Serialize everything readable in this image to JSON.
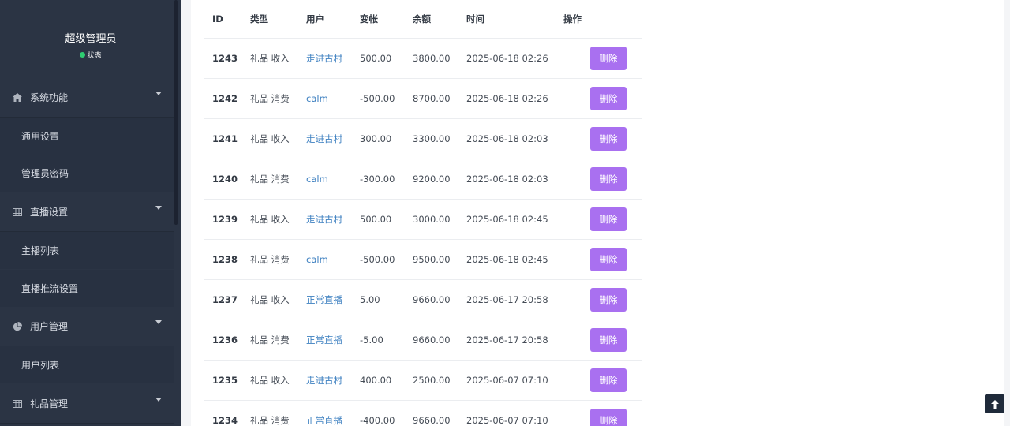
{
  "sidebar": {
    "profile_name": "超级管理员",
    "profile_status": "状态",
    "groups": [
      {
        "label": "系统功能",
        "icon": "home-icon"
      },
      {
        "label": "直播设置",
        "icon": "table-icon"
      },
      {
        "label": "用户管理",
        "icon": "pie-chart-icon"
      },
      {
        "label": "礼品管理",
        "icon": "table-icon"
      }
    ],
    "subitems": [
      "通用设置",
      "管理员密码",
      "主播列表",
      "直播推流设置",
      "用户列表"
    ]
  },
  "table": {
    "headers": [
      "ID",
      "类型",
      "用户",
      "变帐",
      "余额",
      "时间",
      "操作"
    ],
    "delete_label": "删除",
    "rows": [
      {
        "id": "1243",
        "type": "礼品 收入",
        "user": "走进古村",
        "change": "500.00",
        "balance": "3800.00",
        "time": "2025-06-18 02:26"
      },
      {
        "id": "1242",
        "type": "礼品 消费",
        "user": "calm",
        "change": "-500.00",
        "balance": "8700.00",
        "time": "2025-06-18 02:26"
      },
      {
        "id": "1241",
        "type": "礼品 收入",
        "user": "走进古村",
        "change": "300.00",
        "balance": "3300.00",
        "time": "2025-06-18 02:03"
      },
      {
        "id": "1240",
        "type": "礼品 消费",
        "user": "calm",
        "change": "-300.00",
        "balance": "9200.00",
        "time": "2025-06-18 02:03"
      },
      {
        "id": "1239",
        "type": "礼品 收入",
        "user": "走进古村",
        "change": "500.00",
        "balance": "3000.00",
        "time": "2025-06-18 02:45"
      },
      {
        "id": "1238",
        "type": "礼品 消费",
        "user": "calm",
        "change": "-500.00",
        "balance": "9500.00",
        "time": "2025-06-18 02:45"
      },
      {
        "id": "1237",
        "type": "礼品 收入",
        "user": "正常直播",
        "change": "5.00",
        "balance": "9660.00",
        "time": "2025-06-17 20:58"
      },
      {
        "id": "1236",
        "type": "礼品 消费",
        "user": "正常直播",
        "change": "-5.00",
        "balance": "9660.00",
        "time": "2025-06-17 20:58"
      },
      {
        "id": "1235",
        "type": "礼品 收入",
        "user": "走进古村",
        "change": "400.00",
        "balance": "2500.00",
        "time": "2025-06-07 07:10"
      },
      {
        "id": "1234",
        "type": "礼品 消费",
        "user": "正常直播",
        "change": "-400.00",
        "balance": "9660.00",
        "time": "2025-06-07 07:10"
      }
    ]
  },
  "colors": {
    "sidebar_bg": "#2b3444",
    "accent_button": "#a970f0",
    "link": "#3c7fc0",
    "status_online": "#2ecc71"
  }
}
